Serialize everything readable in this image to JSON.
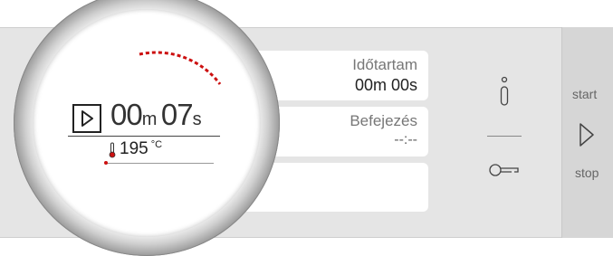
{
  "timer": {
    "minutes": "00",
    "minutes_unit": "m",
    "seconds": "07",
    "seconds_unit": "s",
    "temperature": "195",
    "temperature_unit": "°C"
  },
  "duration": {
    "label": "Időtartam",
    "value": "00m 00s"
  },
  "end_time": {
    "label": "Befejezés",
    "value": "--:--"
  },
  "controls": {
    "start_label": "start",
    "stop_label": "stop"
  },
  "colors": {
    "accent": "#cc1010",
    "panel": "#e5e5e5"
  },
  "icons": [
    "play-icon",
    "thermometer-icon",
    "info-icon",
    "key-icon",
    "start-stop-arrow-icon"
  ]
}
